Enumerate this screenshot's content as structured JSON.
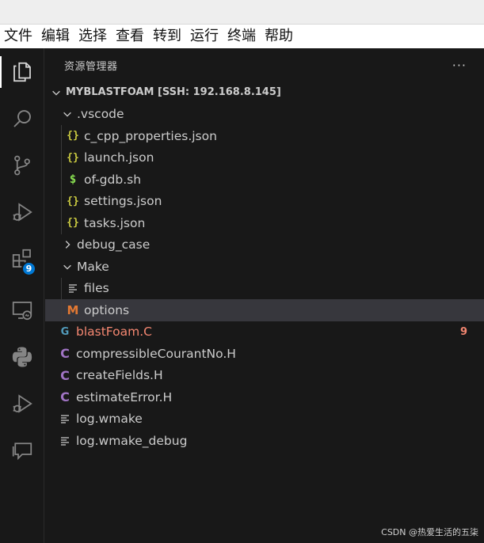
{
  "menubar": [
    "文件",
    "编辑",
    "选择",
    "查看",
    "转到",
    "运行",
    "终端",
    "帮助"
  ],
  "activity": {
    "extensions_badge": "9"
  },
  "explorer": {
    "title": "资源管理器",
    "more": "···",
    "root": "MYBLASTFOAM [SSH: 192.168.8.145]",
    "items": {
      "vscode": ".vscode",
      "c_cpp": "c_cpp_properties.json",
      "launch": "launch.json",
      "ofgdb": "of-gdb.sh",
      "settings": "settings.json",
      "tasks": "tasks.json",
      "debug_case": "debug_case",
      "make": "Make",
      "files": "files",
      "options": "options",
      "blastfoam": "blastFoam.C",
      "blastfoam_problems": "9",
      "courant": "compressibleCourantNo.H",
      "createfields": "createFields.H",
      "estimate": "estimateError.H",
      "logwmake": "log.wmake",
      "logwmakedebug": "log.wmake_debug"
    },
    "icons": {
      "json": "{}",
      "sh": "$",
      "m": "M",
      "c": "C",
      "cpp": "G"
    }
  },
  "colors": {
    "background": "#181818",
    "selected_row": "#37373d",
    "badge": "#0078d4",
    "error_text": "#f48771",
    "json_icon": "#cbcb41",
    "c_icon": "#a074c4",
    "make_icon": "#e37933"
  },
  "watermark": "CSDN @热爱生活的五柒"
}
